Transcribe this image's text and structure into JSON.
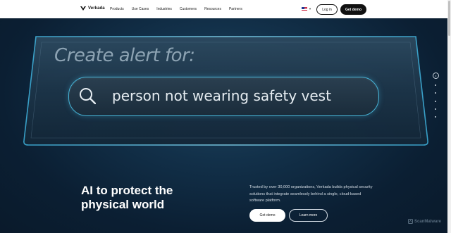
{
  "header": {
    "logo_text": "Verkada",
    "nav": [
      "Products",
      "Use Cases",
      "Industries",
      "Customers",
      "Resources",
      "Partners"
    ],
    "language_icon": "us-flag-icon",
    "login_label": "Log in",
    "demo_label": "Get demo"
  },
  "hero": {
    "alert_title": "Create alert for:",
    "search_text": "person not wearing safety vest",
    "pager_active_label": "II",
    "headline_line1": "AI to protect the",
    "headline_line2": "physical world",
    "description": "Trusted by over 30,000 organizations, Verkada builds physical security solutions that integrate seamlessly behind a single, cloud-based software platform.",
    "demo_label": "Get demo",
    "learn_label": "Learn more"
  },
  "watermark": {
    "text": "ScanMalware"
  },
  "colors": {
    "accent_glow": "#46b3d6",
    "hero_bg": "#0b1d2f",
    "header_bg": "#ffffff"
  }
}
